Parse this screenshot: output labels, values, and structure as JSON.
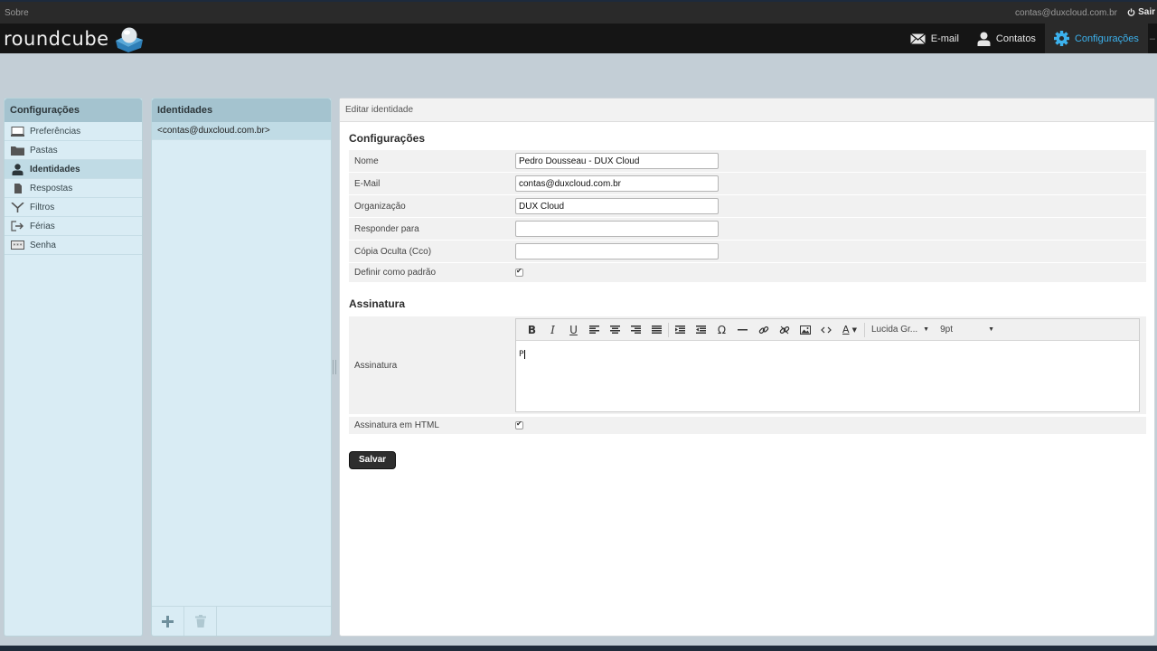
{
  "topbar": {
    "about": "Sobre",
    "user_email": "contas@duxcloud.com.br",
    "logout": "Sair"
  },
  "header": {
    "logo_text": "roundcube",
    "tasks": [
      {
        "label": "E-mail",
        "icon": "envelope-icon"
      },
      {
        "label": "Contatos",
        "icon": "person-icon"
      },
      {
        "label": "Configurações",
        "icon": "gear-icon",
        "active": true
      }
    ],
    "active_color": "#3cb2ee"
  },
  "settings_nav": {
    "title": "Configurações",
    "items": [
      {
        "label": "Preferências",
        "icon": "monitor-icon"
      },
      {
        "label": "Pastas",
        "icon": "folder-icon"
      },
      {
        "label": "Identidades",
        "icon": "person-icon",
        "selected": true
      },
      {
        "label": "Respostas",
        "icon": "document-icon"
      },
      {
        "label": "Filtros",
        "icon": "filter-icon"
      },
      {
        "label": "Férias",
        "icon": "vacation-icon"
      },
      {
        "label": "Senha",
        "icon": "password-icon"
      }
    ]
  },
  "identities": {
    "title": "Identidades",
    "items": [
      "<contas@duxcloud.com.br>"
    ]
  },
  "edit": {
    "header": "Editar identidade",
    "section_settings": "Configurações",
    "fields": {
      "name_label": "Nome",
      "name_value": "Pedro Dousseau - DUX Cloud",
      "email_label": "E-Mail",
      "email_value": "contas@duxcloud.com.br",
      "org_label": "Organização",
      "org_value": "DUX Cloud",
      "reply_label": "Responder para",
      "reply_value": "",
      "bcc_label": "Cópia Oculta (Cco)",
      "bcc_value": "",
      "default_label": "Definir como padrão",
      "default_checked": true
    },
    "section_signature": "Assinatura",
    "signature_label": "Assinatura",
    "signature_text": "P",
    "toolbar": {
      "font": "Lucida Gr...",
      "size": "9pt",
      "special_char": "Ω",
      "text_color": "A"
    },
    "html_signature_label": "Assinatura em HTML",
    "html_signature_checked": true,
    "save_label": "Salvar"
  }
}
